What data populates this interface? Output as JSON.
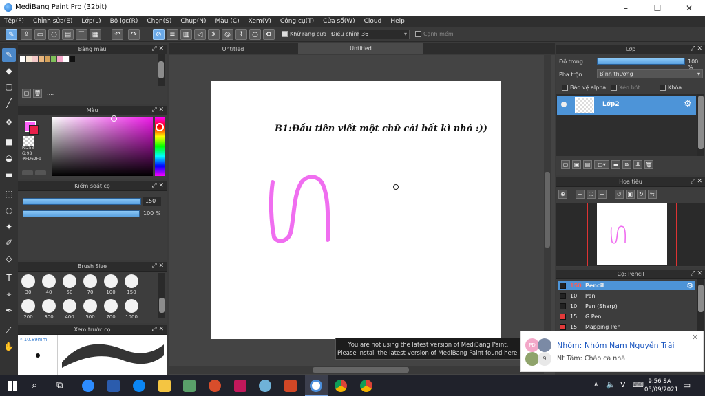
{
  "app": {
    "title": "MediBang Paint Pro (32bit)",
    "win_min": "–",
    "win_max": "☐",
    "win_close": "✕"
  },
  "menu": [
    "Tệp(F)",
    "Chỉnh sửa(E)",
    "Lớp(L)",
    "Bộ lọc(R)",
    "Chọn(S)",
    "Chụp(N)",
    "Màu (C)",
    "Xem(V)",
    "Công cụ(T)",
    "Cửa sổ(W)",
    "Cloud",
    "Help"
  ],
  "toolbar": {
    "antialias_label": "Khử răng cưa",
    "adjust_label": "Điều chỉnh",
    "adjust_value": "36",
    "edge_label": "Cạnh mềm"
  },
  "tabs": [
    "Untitled",
    "Untitled"
  ],
  "palette": {
    "title": "Bảng màu",
    "swatches": [
      "#ffffff",
      "#f6e7d3",
      "#f3c8c8",
      "#e9b77f",
      "#d4a05a",
      "#7fbf5a",
      "#f3a6c8",
      "#ffffff",
      "#111111"
    ],
    "name": "...."
  },
  "color": {
    "title": "Màu",
    "r": "R:253",
    "g": "G:98",
    "b": "#FD62F9",
    "primary": "#fd62f9"
  },
  "brush_control": {
    "title": "Kiểm soát cọ",
    "size": "150",
    "opacity": "100 %"
  },
  "brush_size": {
    "title": "Brush Size",
    "sizes": [
      "30",
      "40",
      "50",
      "70",
      "100",
      "150",
      "200",
      "300",
      "400",
      "500",
      "700",
      "1000"
    ]
  },
  "preview": {
    "title": "Xem trước cọ",
    "size": "* 10.89mm"
  },
  "canvas": {
    "text": "B1:Đầu tiên viết một chữ cái bất kì nhó :))",
    "stroke_color": "#f06ef0"
  },
  "notice": {
    "line1": "You are not using the latest version of MediBang Paint.",
    "line2": "Please install the latest version of MediBang Paint found here."
  },
  "layer_panel": {
    "title": "Lớp",
    "opacity_label": "Độ trong",
    "opacity_value": "100 %",
    "blend_label": "Pha trộn",
    "blend_value": "Bình thường",
    "protect_alpha": "Bảo vệ alpha",
    "clip": "Xén bớt",
    "lock": "Khóa",
    "layer_name": "Lớp2"
  },
  "navigator": {
    "title": "Hoa tiêu"
  },
  "brush_panel": {
    "title": "Cọ: Pencil",
    "items": [
      {
        "size": "150",
        "name": "Pencil",
        "color": "#222222"
      },
      {
        "size": "10",
        "name": "Pen",
        "color": "#222222"
      },
      {
        "size": "10",
        "name": "Pen (Sharp)",
        "color": "#222222"
      },
      {
        "size": "15",
        "name": "G Pen",
        "color": "#e33a3a"
      },
      {
        "size": "15",
        "name": "Mapping Pen",
        "color": "#e33a3a"
      }
    ]
  },
  "chat": {
    "title": "Nhóm: Nhóm Nam Nguyễn Trãi",
    "message": "Nt Tâm: Chào cả nhà",
    "avatar_text": "PD",
    "count": "9",
    "close": "✕"
  },
  "taskbar": {
    "time": "9:56 SA",
    "date": "05/09/2021",
    "lang": "V",
    "caret": "∧"
  }
}
